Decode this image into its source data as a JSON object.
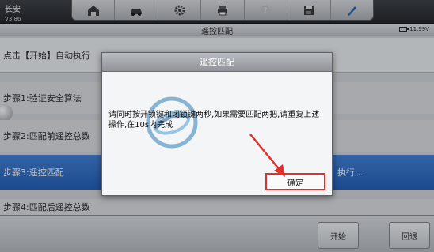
{
  "app": {
    "name": "长安",
    "version": "V3.86"
  },
  "toolbar": {
    "icons": [
      "home-icon",
      "car-icon",
      "settings-icon",
      "print-icon",
      "help-icon",
      "save-icon",
      "edit-icon"
    ]
  },
  "titlebar": {
    "title": "遥控匹配",
    "battery": "11.99V"
  },
  "steps": {
    "instruction": "点击【开始】自动执行",
    "step1": "步骤1:验证安全算法",
    "step2": "步骤2:匹配前遥控总数",
    "step3": "步骤3:遥控匹配",
    "step3_status": "执行...",
    "step4": "步骤4:匹配后遥控总数"
  },
  "bottom": {
    "start_label": "开始",
    "back_label": "回退"
  },
  "dialog": {
    "title": "遥控匹配",
    "message": "请同时按开锁键和闭锁键两秒,如果需要匹配两把,请重复上述操作,在10s内完成",
    "ok_label": "确定"
  },
  "colors": {
    "highlight": "#2a66c2",
    "annotation": "#e03030"
  }
}
